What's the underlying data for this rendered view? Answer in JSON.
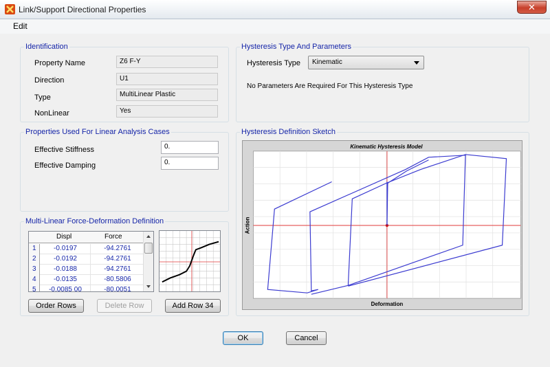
{
  "window": {
    "title": "Link/Support Directional Properties",
    "close_glyph": "✕"
  },
  "menu": {
    "edit": "Edit"
  },
  "identification": {
    "title": "Identification",
    "property_name_label": "Property Name",
    "property_name_value": "Z6 F-Y",
    "direction_label": "Direction",
    "direction_value": "U1",
    "type_label": "Type",
    "type_value": "MultiLinear Plastic",
    "nonlinear_label": "NonLinear",
    "nonlinear_value": "Yes"
  },
  "hysteresis": {
    "title": "Hysteresis Type And Parameters",
    "type_label": "Hysteresis Type",
    "type_value": "Kinematic",
    "message": "No Parameters Are Required For This Hysteresis Type"
  },
  "linear": {
    "title": "Properties Used For Linear Analysis Cases",
    "stiffness_label": "Effective Stiffness",
    "stiffness_value": "0.",
    "damping_label": "Effective Damping",
    "damping_value": "0."
  },
  "multilinear": {
    "title": "Multi-Linear Force-Deformation Definition",
    "col_displ": "Displ",
    "col_force": "Force",
    "rows": [
      {
        "n": "1",
        "displ": "-0.0197",
        "force": "-94.2761"
      },
      {
        "n": "2",
        "displ": "-0.0192",
        "force": "-94.2761"
      },
      {
        "n": "3",
        "displ": "-0.0188",
        "force": "-94.2761"
      },
      {
        "n": "4",
        "displ": "-0.0135",
        "force": "-80.5806"
      },
      {
        "n": "5",
        "displ": "-0.0085 00",
        "force": "-80.0051"
      }
    ],
    "order_rows": "Order Rows",
    "delete_row": "Delete Row",
    "add_row": "Add Row 34"
  },
  "sketch": {
    "title": "Hysteresis Definition Sketch",
    "plot_title": "Kinematic Hysteresis Model",
    "x_label": "Deformation",
    "y_label": "Action"
  },
  "buttons": {
    "ok": "OK",
    "cancel": "Cancel"
  },
  "colors": {
    "accent_text": "#1525a8",
    "curve": "#3a3ad0",
    "axis": "#e03a3a"
  }
}
